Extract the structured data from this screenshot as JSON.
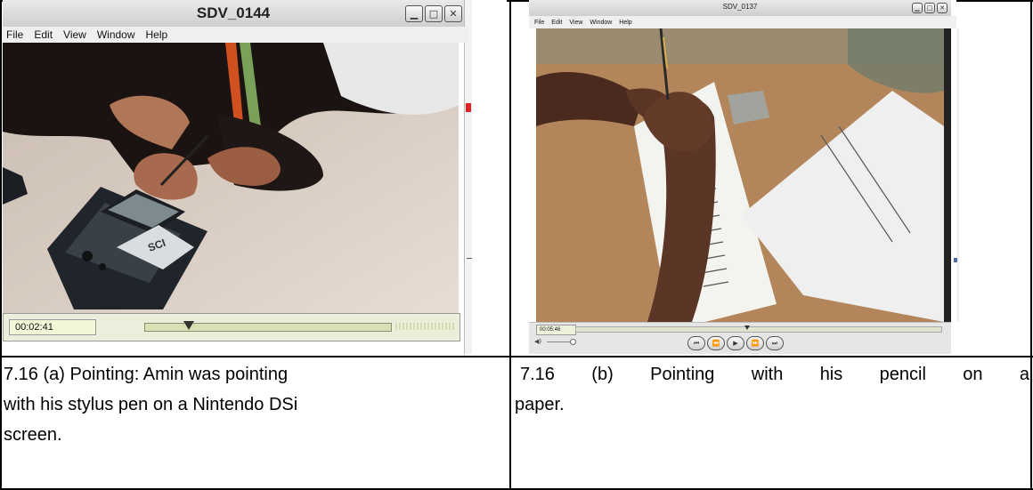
{
  "figure_a": {
    "window_title": "SDV_0144",
    "menu": [
      "File",
      "Edit",
      "View",
      "Window",
      "Help"
    ],
    "timecode": "00:02:41",
    "progress": 0.18,
    "caption_lines": [
      "7.16 (a) Pointing:  Amin was pointing",
      "with his stylus pen on a Nintendo DSi",
      "screen."
    ]
  },
  "figure_b": {
    "window_title": "SDV_0137",
    "menu": [
      "File",
      "Edit",
      "View",
      "Window",
      "Help"
    ],
    "timecode": "00:05:46",
    "progress": 0.47,
    "caption_words_line1": [
      "7.16",
      "(b)",
      "Pointing",
      "with",
      "his",
      "pencil",
      "on",
      "a"
    ],
    "caption_line2": "paper."
  },
  "icons": {
    "minimize": "minimize-icon",
    "maximize": "maximize-icon",
    "close": "close-icon",
    "volume": "volume-icon",
    "prev": "skip-back-icon",
    "rewind": "rewind-icon",
    "play": "play-icon",
    "forward": "fast-forward-icon",
    "next": "skip-forward-icon"
  }
}
